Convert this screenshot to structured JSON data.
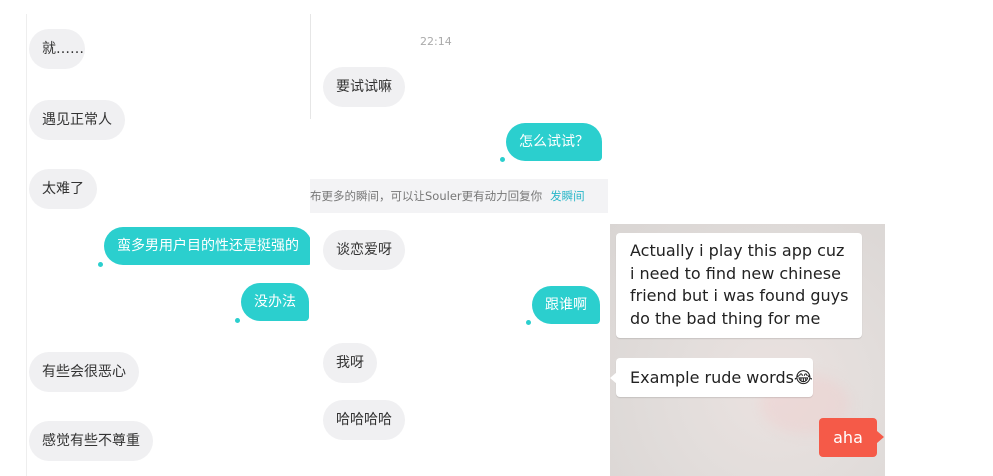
{
  "left_panel": {
    "messages": [
      {
        "text": "就……",
        "dir": "in"
      },
      {
        "text": "遇见正常人",
        "dir": "in"
      },
      {
        "text": "太难了",
        "dir": "in"
      },
      {
        "text": "蛮多男用户目的性还是挺强的",
        "dir": "out"
      },
      {
        "text": "没办法",
        "dir": "out"
      },
      {
        "text": "有些会很恶心",
        "dir": "in"
      },
      {
        "text": "感觉有些不尊重",
        "dir": "in"
      }
    ]
  },
  "middle_panel": {
    "timestamp": "22:14",
    "notice": {
      "text": "布更多的瞬间，可以让Souler更有动力回复你",
      "link": "发瞬间"
    },
    "messages": [
      {
        "text": "要试试嘛",
        "dir": "in"
      },
      {
        "text": "怎么试试？",
        "dir": "out"
      },
      {
        "text": "谈恋爱呀",
        "dir": "in"
      },
      {
        "text": "跟谁啊",
        "dir": "out"
      },
      {
        "text": "我呀",
        "dir": "in"
      },
      {
        "text": "哈哈哈哈",
        "dir": "in"
      }
    ]
  },
  "right_panel": {
    "messages": [
      {
        "text": "Actually i play this app cuz i need to find new chinese friend but i was found guys do the bad thing for me",
        "dir": "in"
      },
      {
        "text": "Example rude words😂",
        "dir": "in"
      },
      {
        "text": "aha",
        "dir": "out"
      }
    ],
    "colors": {
      "background": "#e4dfdd",
      "outgoing": "#f55a48"
    }
  },
  "colors": {
    "accent": "#2bcfce",
    "incoming_bubble": "#f0f0f2",
    "link": "#2bb7c9"
  }
}
